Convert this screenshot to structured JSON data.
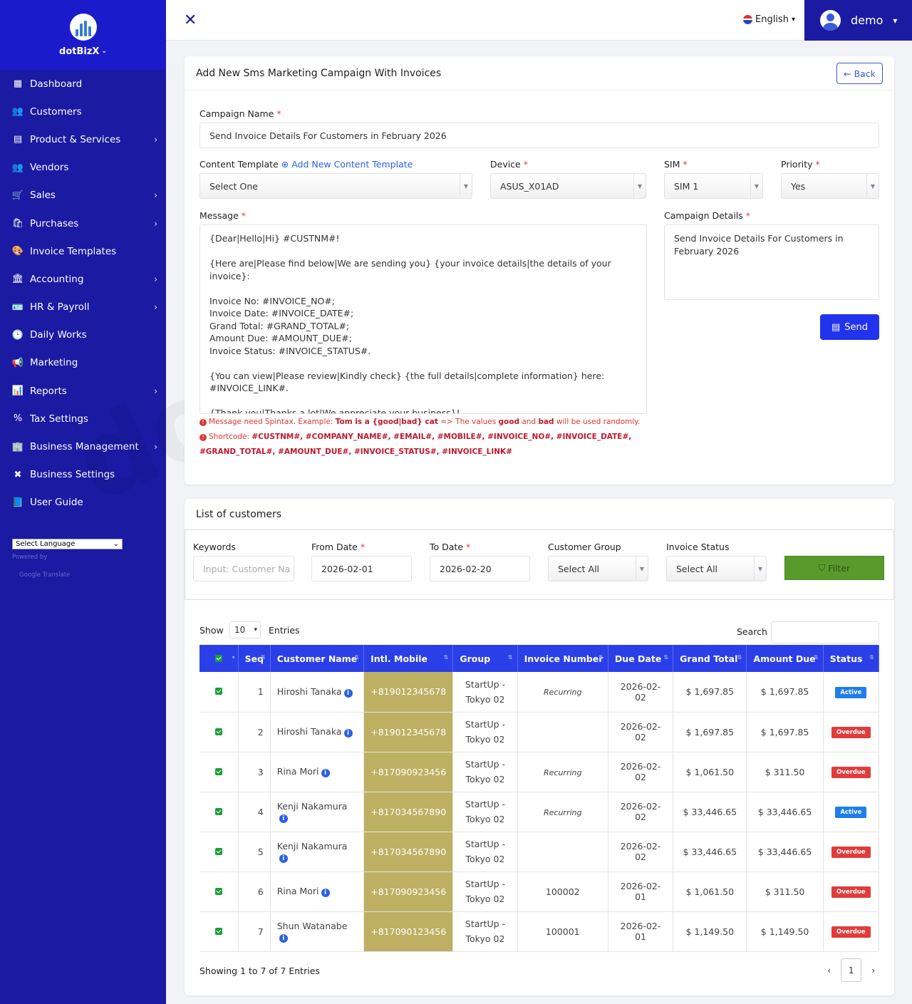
{
  "brand": {
    "name": "dotBizX"
  },
  "sidebar": {
    "items": [
      {
        "label": "Dashboard",
        "icon": "dashboard-icon",
        "glyph": "▦",
        "has_sub": false
      },
      {
        "label": "Customers",
        "icon": "users-icon",
        "glyph": "👥",
        "has_sub": false
      },
      {
        "label": "Product & Services",
        "icon": "box-icon",
        "glyph": "▤",
        "has_sub": true
      },
      {
        "label": "Vendors",
        "icon": "users-icon",
        "glyph": "👥",
        "has_sub": false
      },
      {
        "label": "Sales",
        "icon": "basket-icon",
        "glyph": "🛒",
        "has_sub": true
      },
      {
        "label": "Purchases",
        "icon": "bag-icon",
        "glyph": "🛍",
        "has_sub": true
      },
      {
        "label": "Invoice Templates",
        "icon": "palette-icon",
        "glyph": "🎨",
        "has_sub": false
      },
      {
        "label": "Accounting",
        "icon": "bank-icon",
        "glyph": "🏛",
        "has_sub": true
      },
      {
        "label": "HR & Payroll",
        "icon": "id-card-icon",
        "glyph": "🪪",
        "has_sub": true
      },
      {
        "label": "Daily Works",
        "icon": "clock-icon",
        "glyph": "🕒",
        "has_sub": false
      },
      {
        "label": "Marketing",
        "icon": "megaphone-icon",
        "glyph": "📢",
        "has_sub": false
      },
      {
        "label": "Reports",
        "icon": "chart-icon",
        "glyph": "📊",
        "has_sub": true
      },
      {
        "label": "Tax Settings",
        "icon": "percent-icon",
        "glyph": "%",
        "has_sub": false
      },
      {
        "label": "Business Management",
        "icon": "building-icon",
        "glyph": "🏢",
        "has_sub": true
      },
      {
        "label": "Business Settings",
        "icon": "tools-icon",
        "glyph": "✖",
        "has_sub": false
      },
      {
        "label": "User Guide",
        "icon": "book-icon",
        "glyph": "📘",
        "has_sub": false
      }
    ],
    "language_select": "Select Language",
    "powered_by": "Powered by",
    "google_translate": "Google Translate"
  },
  "topbar": {
    "language": "English",
    "username": "demo"
  },
  "form": {
    "title": "Add New Sms Marketing Campaign With Invoices",
    "back_label": "Back",
    "campaign_name_label": "Campaign Name",
    "campaign_name_value": "Send Invoice Details For Customers in February 2026",
    "content_template_label": "Content Template",
    "add_template_link": "Add New Content Template",
    "content_template_value": "Select One",
    "device_label": "Device",
    "device_value": "ASUS_X01AD",
    "sim_label": "SIM",
    "sim_value": "SIM 1",
    "priority_label": "Priority",
    "priority_value": "Yes",
    "message_label": "Message",
    "message_value": "{Dear|Hello|Hi} #CUSTNM#!\n\n{Here are|Please find below|We are sending you} {your invoice details|the details of your invoice}:\n\nInvoice No: #INVOICE_NO#;\nInvoice Date: #INVOICE_DATE#;\nGrand Total: #GRAND_TOTAL#;\nAmount Due: #AMOUNT_DUE#;\nInvoice Status: #INVOICE_STATUS#.\n\n{You can view|Please review|Kindly check} {the full details|complete information} here:\n#INVOICE_LINK#.\n\n{Thank you|Thanks a lot|We appreciate your business}!",
    "campaign_details_label": "Campaign Details",
    "campaign_details_value": "Send Invoice Details For Customers in February 2026",
    "send_label": "Send",
    "note1_prefix": "Message need Spintax. Example: ",
    "note1_example": "Tom is a {good|bad} cat",
    "note1_mid": " => The values ",
    "note1_good": "good",
    "note1_and": " and ",
    "note1_bad": "bad",
    "note1_suffix": " will be used randomly.",
    "note2_prefix": "Shortcode: ",
    "note2_codes1": "#CUSTNM#, #COMPANY_NAME#, #EMAIL#, #MOBILE#, #INVOICE_NO#, #INVOICE_DATE#,",
    "note2_codes2": "#GRAND_TOTAL#, #AMOUNT_DUE#, #INVOICE_STATUS#, #INVOICE_LINK#"
  },
  "customers": {
    "title": "List of customers",
    "keywords_label": "Keywords",
    "keywords_placeholder": "Input: Customer Na",
    "from_date_label": "From Date",
    "from_date_value": "2026-02-01",
    "to_date_label": "To Date",
    "to_date_value": "2026-02-20",
    "group_label": "Customer Group",
    "group_value": "Select All",
    "status_label": "Invoice Status",
    "status_value": "Select All",
    "filter_label": "Filter",
    "show_label": "Show",
    "show_value": "10",
    "entries_label": "Entries",
    "search_label": "Search",
    "columns": [
      "Seq",
      "Customer Name",
      "Intl. Mobile",
      "Group",
      "Invoice Number",
      "Due Date",
      "Grand Total",
      "Amount Due",
      "Status"
    ],
    "rows": [
      {
        "seq": "1",
        "name": "Hiroshi Tanaka",
        "mobile": "+819012345678",
        "group1": "StartUp -",
        "group2": "Tokyo 02",
        "invoice": "Recurring",
        "due": "2026-02-02",
        "grand": "$ 1,697.85",
        "amount": "$ 1,697.85",
        "status": "Active"
      },
      {
        "seq": "2",
        "name": "Hiroshi Tanaka",
        "mobile": "+819012345678",
        "group1": "StartUp -",
        "group2": "Tokyo 02",
        "invoice": "",
        "due": "2026-02-02",
        "grand": "$ 1,697.85",
        "amount": "$ 1,697.85",
        "status": "Overdue"
      },
      {
        "seq": "3",
        "name": "Rina Mori",
        "mobile": "+817090923456",
        "group1": "StartUp -",
        "group2": "Tokyo 02",
        "invoice": "Recurring",
        "due": "2026-02-02",
        "grand": "$ 1,061.50",
        "amount": "$ 311.50",
        "status": "Overdue"
      },
      {
        "seq": "4",
        "name": "Kenji Nakamura",
        "mobile": "+817034567890",
        "group1": "StartUp -",
        "group2": "Tokyo 02",
        "invoice": "Recurring",
        "due": "2026-02-02",
        "grand": "$ 33,446.65",
        "amount": "$ 33,446.65",
        "status": "Active"
      },
      {
        "seq": "5",
        "name": "Kenji Nakamura",
        "mobile": "+817034567890",
        "group1": "StartUp -",
        "group2": "Tokyo 02",
        "invoice": "",
        "due": "2026-02-02",
        "grand": "$ 33,446.65",
        "amount": "$ 33,446.65",
        "status": "Overdue"
      },
      {
        "seq": "6",
        "name": "Rina Mori",
        "mobile": "+817090923456",
        "group1": "StartUp -",
        "group2": "Tokyo 02",
        "invoice": "100002",
        "due": "2026-02-01",
        "grand": "$ 1,061.50",
        "amount": "$ 311.50",
        "status": "Overdue"
      },
      {
        "seq": "7",
        "name": "Shun Watanabe",
        "mobile": "+817090123456",
        "group1": "StartUp -",
        "group2": "Tokyo 02",
        "invoice": "100001",
        "due": "2026-02-01",
        "grand": "$ 1,149.50",
        "amount": "$ 1,149.50",
        "status": "Overdue"
      }
    ],
    "showing_text": "Showing 1 to 7 of 7 Entries",
    "current_page": "1"
  },
  "colors": {
    "sidebar": "#1a1aa3",
    "accent": "#2b3fe8",
    "filter": "#5a9a2d",
    "mobile_cell": "#bdb063",
    "active": "#1e7ef0",
    "overdue": "#e23b3b"
  }
}
